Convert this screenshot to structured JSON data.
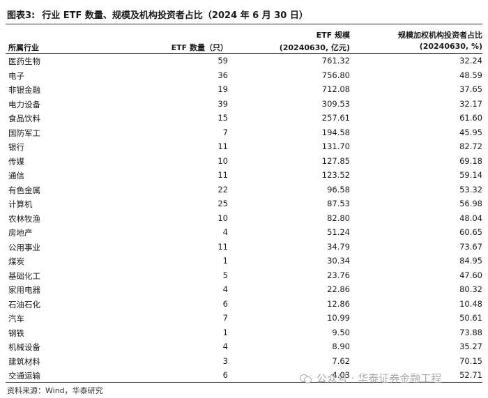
{
  "title": {
    "prefix": "图表3:",
    "text": "行业 ETF 数量、规模及机构投资者占比（2024 年 6 月 30 日）"
  },
  "columns": {
    "industry": "所属行业",
    "count": "ETF 数量（只）",
    "scale_line1": "ETF 规模",
    "scale_line2": "(20240630, 亿元)",
    "inst_line1": "规模加权机构投资者占比",
    "inst_line2": "(20240630, %)"
  },
  "rows": [
    {
      "industry": "医药生物",
      "count": "59",
      "scale": "761.32",
      "inst": "32.24"
    },
    {
      "industry": "电子",
      "count": "36",
      "scale": "756.80",
      "inst": "48.59"
    },
    {
      "industry": "非银金融",
      "count": "19",
      "scale": "712.08",
      "inst": "37.65"
    },
    {
      "industry": "电力设备",
      "count": "39",
      "scale": "309.53",
      "inst": "32.17"
    },
    {
      "industry": "食品饮料",
      "count": "15",
      "scale": "257.61",
      "inst": "61.60"
    },
    {
      "industry": "国防军工",
      "count": "7",
      "scale": "194.58",
      "inst": "45.95"
    },
    {
      "industry": "银行",
      "count": "11",
      "scale": "131.70",
      "inst": "82.72"
    },
    {
      "industry": "传媒",
      "count": "10",
      "scale": "127.85",
      "inst": "69.18"
    },
    {
      "industry": "通信",
      "count": "11",
      "scale": "123.52",
      "inst": "59.14"
    },
    {
      "industry": "有色金属",
      "count": "22",
      "scale": "96.58",
      "inst": "53.32"
    },
    {
      "industry": "计算机",
      "count": "25",
      "scale": "87.53",
      "inst": "56.98"
    },
    {
      "industry": "农林牧渔",
      "count": "10",
      "scale": "82.80",
      "inst": "48.04"
    },
    {
      "industry": "房地产",
      "count": "4",
      "scale": "51.24",
      "inst": "60.65"
    },
    {
      "industry": "公用事业",
      "count": "11",
      "scale": "34.79",
      "inst": "73.67"
    },
    {
      "industry": "煤炭",
      "count": "1",
      "scale": "30.34",
      "inst": "84.95"
    },
    {
      "industry": "基础化工",
      "count": "5",
      "scale": "23.76",
      "inst": "47.60"
    },
    {
      "industry": "家用电器",
      "count": "4",
      "scale": "22.86",
      "inst": "80.32"
    },
    {
      "industry": "石油石化",
      "count": "6",
      "scale": "12.86",
      "inst": "10.48"
    },
    {
      "industry": "汽车",
      "count": "7",
      "scale": "10.99",
      "inst": "50.61"
    },
    {
      "industry": "钢铁",
      "count": "1",
      "scale": "9.50",
      "inst": "73.88"
    },
    {
      "industry": "机械设备",
      "count": "4",
      "scale": "8.90",
      "inst": "35.27"
    },
    {
      "industry": "建筑材料",
      "count": "3",
      "scale": "7.62",
      "inst": "70.15"
    },
    {
      "industry": "交通运输",
      "count": "6",
      "scale": "4.03",
      "inst": "52.71"
    }
  ],
  "source": "资料来源：Wind，华泰研究",
  "watermark": "公众号 · 华泰证券金融工程",
  "icons": {
    "watermark": "wechat-icon"
  }
}
